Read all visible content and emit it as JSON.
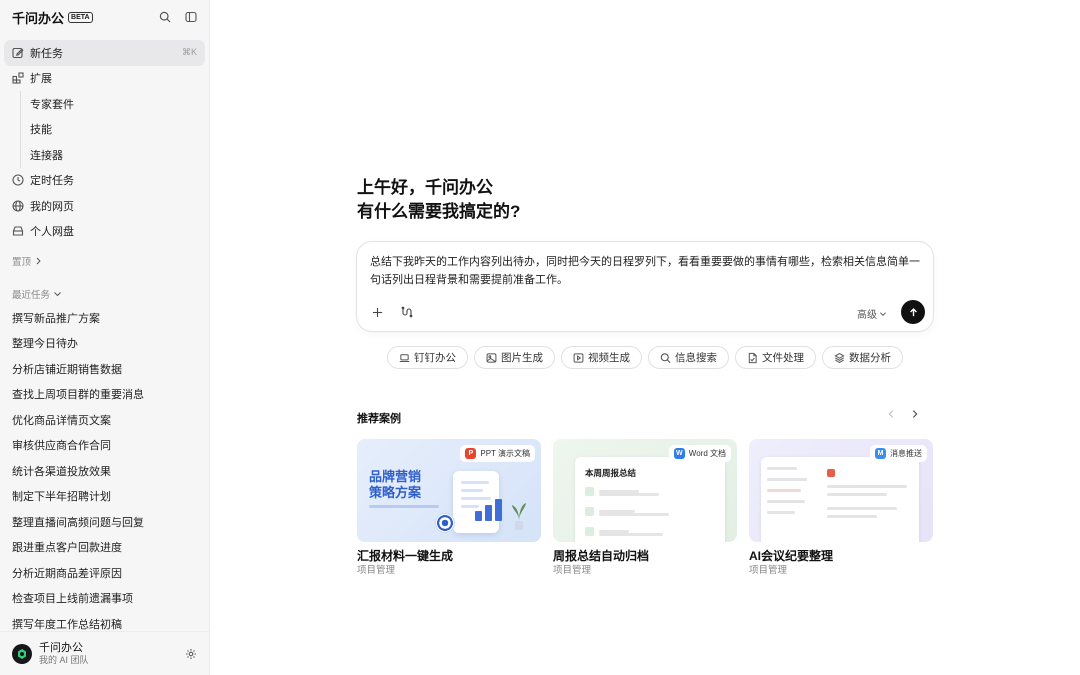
{
  "sidebar": {
    "brand": "千问办公",
    "beta": "BETA",
    "nav": [
      {
        "label": "新任务",
        "shortcut": "⌘K"
      },
      {
        "label": "扩展"
      },
      {
        "label": "定时任务"
      },
      {
        "label": "我的网页"
      },
      {
        "label": "个人网盘"
      }
    ],
    "sub": [
      "专家套件",
      "技能",
      "连接器"
    ],
    "pinned_label": "置顶",
    "recent_label": "最近任务",
    "recent": [
      "撰写新品推广方案",
      "整理今日待办",
      "分析店铺近期销售数据",
      "查找上周项目群的重要消息",
      "优化商品详情页文案",
      "审核供应商合作合同",
      "统计各渠道投放效果",
      "制定下半年招聘计划",
      "整理直播间高频问题与回复",
      "跟进重点客户回款进度",
      "分析近期商品差评原因",
      "检查项目上线前遗漏事项",
      "撰写年度工作总结初稿"
    ],
    "user": {
      "name": "千问办公",
      "sub": "我的 AI 团队"
    }
  },
  "main": {
    "greeting_line1": "上午好，千问办公",
    "greeting_line2": "有什么需要我搞定的?",
    "composer": {
      "text": "总结下我昨天的工作内容列出待办，同时把今天的日程罗列下，看看重要要做的事情有哪些，检索相关信息简单一句话列出日程背景和需要提前准备工作。",
      "advanced": "高级"
    },
    "chips": [
      {
        "label": "钉钉办公",
        "icon": "laptop-icon"
      },
      {
        "label": "图片生成",
        "icon": "image-icon"
      },
      {
        "label": "视频生成",
        "icon": "video-icon"
      },
      {
        "label": "信息搜索",
        "icon": "search-icon"
      },
      {
        "label": "文件处理",
        "icon": "file-icon"
      },
      {
        "label": "数据分析",
        "icon": "data-icon"
      }
    ],
    "recommend_title": "推荐案例",
    "cards": [
      {
        "title": "汇报材料一键生成",
        "sub": "项目管理",
        "tag": "PPT 演示文稿",
        "tag_letter": "P",
        "tag_color": "#e8452f",
        "poster_l1": "品牌营销",
        "poster_l2": "策略方案"
      },
      {
        "title": "周报总结自动归档",
        "sub": "项目管理",
        "tag": "Word 文档",
        "tag_letter": "W",
        "tag_color": "#2f7de8",
        "doc_title": "本周周报总结"
      },
      {
        "title": "AI会议纪要整理",
        "sub": "项目管理",
        "tag": "消息推送",
        "tag_letter": "M",
        "tag_color": "#3a8df2"
      }
    ]
  }
}
